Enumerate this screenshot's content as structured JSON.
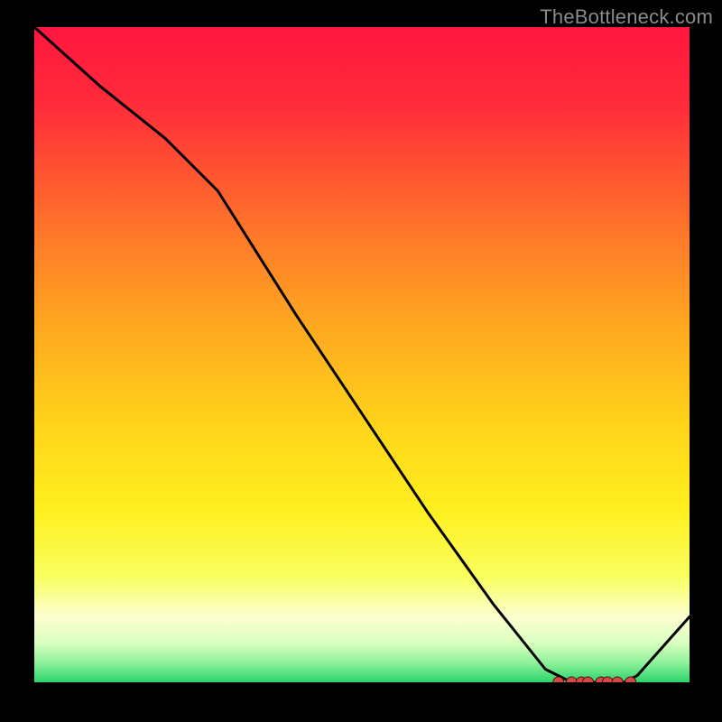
{
  "watermark": "TheBottleneck.com",
  "colors": {
    "marker_fill": "#d24a4a",
    "marker_stroke": "#5a0b0b",
    "curve": "#000000"
  },
  "chart_data": {
    "type": "line",
    "title": "",
    "xlabel": "",
    "ylabel": "",
    "xlim": [
      0,
      100
    ],
    "ylim": [
      0,
      100
    ],
    "series": [
      {
        "name": "bottleneck-curve",
        "x": [
          0,
          10,
          20,
          28,
          40,
          50,
          60,
          70,
          78,
          82,
          86,
          90,
          92,
          100
        ],
        "y": [
          100,
          91,
          83,
          75,
          56,
          41,
          26,
          12,
          2,
          0,
          0,
          0,
          1,
          10
        ]
      }
    ],
    "markers": {
      "name": "recommended-range",
      "x": [
        80,
        82,
        83.5,
        84.5,
        86.5,
        87.5,
        89,
        91
      ],
      "y": [
        0,
        0,
        0,
        0,
        0,
        0,
        0,
        0
      ]
    }
  }
}
